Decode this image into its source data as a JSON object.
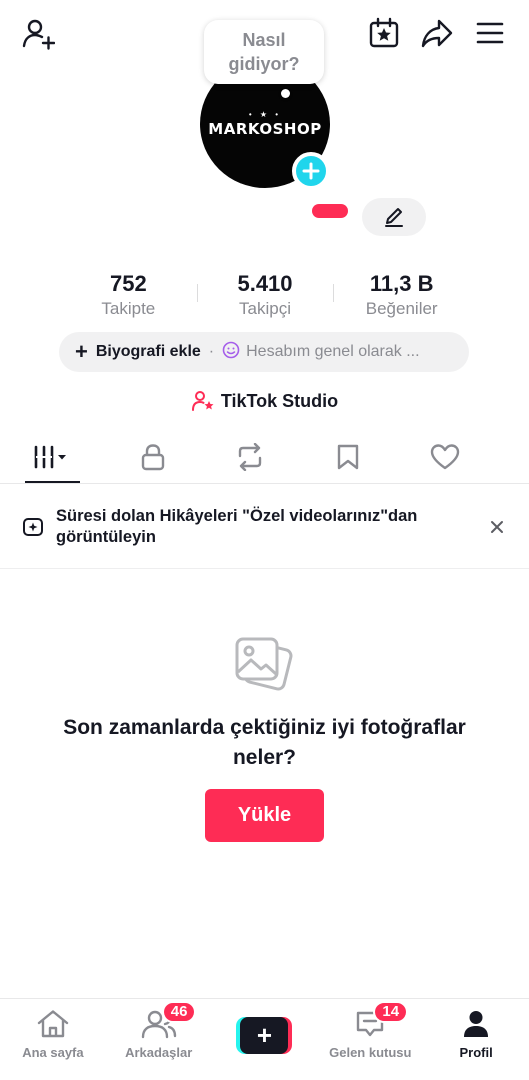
{
  "bubble": {
    "text_line1": "Nasıl",
    "text_line2": "gidiyor?"
  },
  "avatar": {
    "brand_text": "MARKOSHOP",
    "stars": "• ★ •"
  },
  "stats": [
    {
      "value": "752",
      "label": "Takipte"
    },
    {
      "value": "5.410",
      "label": "Takipçi"
    },
    {
      "value": "11,3 B",
      "label": "Beğeniler"
    }
  ],
  "bio": {
    "add_label": "Biyografi ekle",
    "separator": "·",
    "status_text": "Hesabım genel olarak ..."
  },
  "studio": {
    "label": "TikTok Studio"
  },
  "notice": {
    "text": "Süresi dolan Hikâyeleri \"Özel videolarınız\"dan görüntüleyin"
  },
  "empty_state": {
    "title": "Son zamanlarda çektiğiniz iyi fotoğraflar neler?",
    "button_label": "Yükle"
  },
  "bottom_nav": {
    "home": {
      "label": "Ana sayfa"
    },
    "friends": {
      "label": "Arkadaşlar",
      "badge": "46"
    },
    "create": {
      "label": "+"
    },
    "inbox": {
      "label": "Gelen kutusu",
      "badge": "14"
    },
    "profile": {
      "label": "Profil"
    }
  },
  "colors": {
    "accent": "#fe2c55",
    "cyan": "#20d5ec",
    "text": "#161823",
    "muted": "#8a8b91"
  },
  "icons": [
    "add-user-icon",
    "calendar-star-icon",
    "share-icon",
    "menu-icon",
    "edit-pencil-icon",
    "grid-icon",
    "lock-icon",
    "repost-icon",
    "bookmark-icon",
    "heart-icon",
    "story-icon",
    "close-icon",
    "photo-icon",
    "home-icon",
    "friends-icon",
    "inbox-icon",
    "profile-icon"
  ]
}
